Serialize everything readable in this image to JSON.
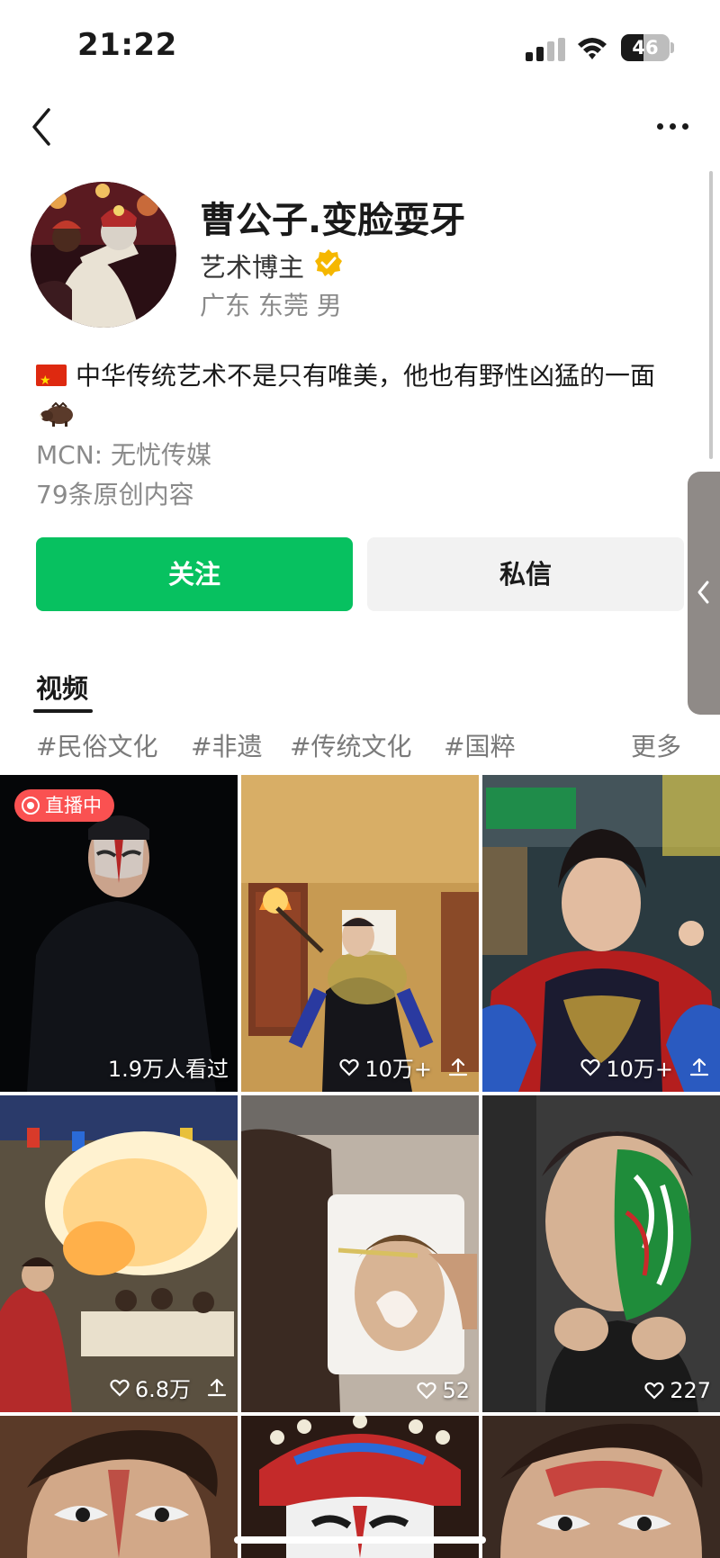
{
  "status_bar": {
    "time": "21:22",
    "battery_level": "46",
    "signal-icon": "cellular-signal-icon",
    "wifi-icon": "wifi-icon"
  },
  "nav": {
    "back_icon": "chevron-left-icon",
    "more_icon": "ellipsis-icon"
  },
  "profile": {
    "name": "曹公子.变脸耍牙",
    "role": "艺术博主",
    "location": "广东 东莞 男",
    "bio_text": "中华传统艺术不是只有唯美，他也有野性凶猛的一面",
    "mcn": "MCN: 无忧传媒",
    "original_count": "79条原创内容",
    "verified_color": "#f5b700"
  },
  "actions": {
    "follow_label": "关注",
    "message_label": "私信",
    "follow_color": "#07c160"
  },
  "tabs": {
    "videos_label": "视频"
  },
  "tags": [
    "#民俗文化",
    "#非遗",
    "#传统文化",
    "#国粹"
  ],
  "tags_more": "更多",
  "videos": [
    {
      "live_label": "直播中",
      "stat": "1.9万人看过"
    },
    {
      "stat": "10万+"
    },
    {
      "stat": "10万+"
    },
    {
      "stat": "6.8万"
    },
    {
      "stat": "52"
    },
    {
      "stat": "227"
    },
    {
      "stat": ""
    },
    {
      "stat": ""
    },
    {
      "stat": ""
    }
  ]
}
